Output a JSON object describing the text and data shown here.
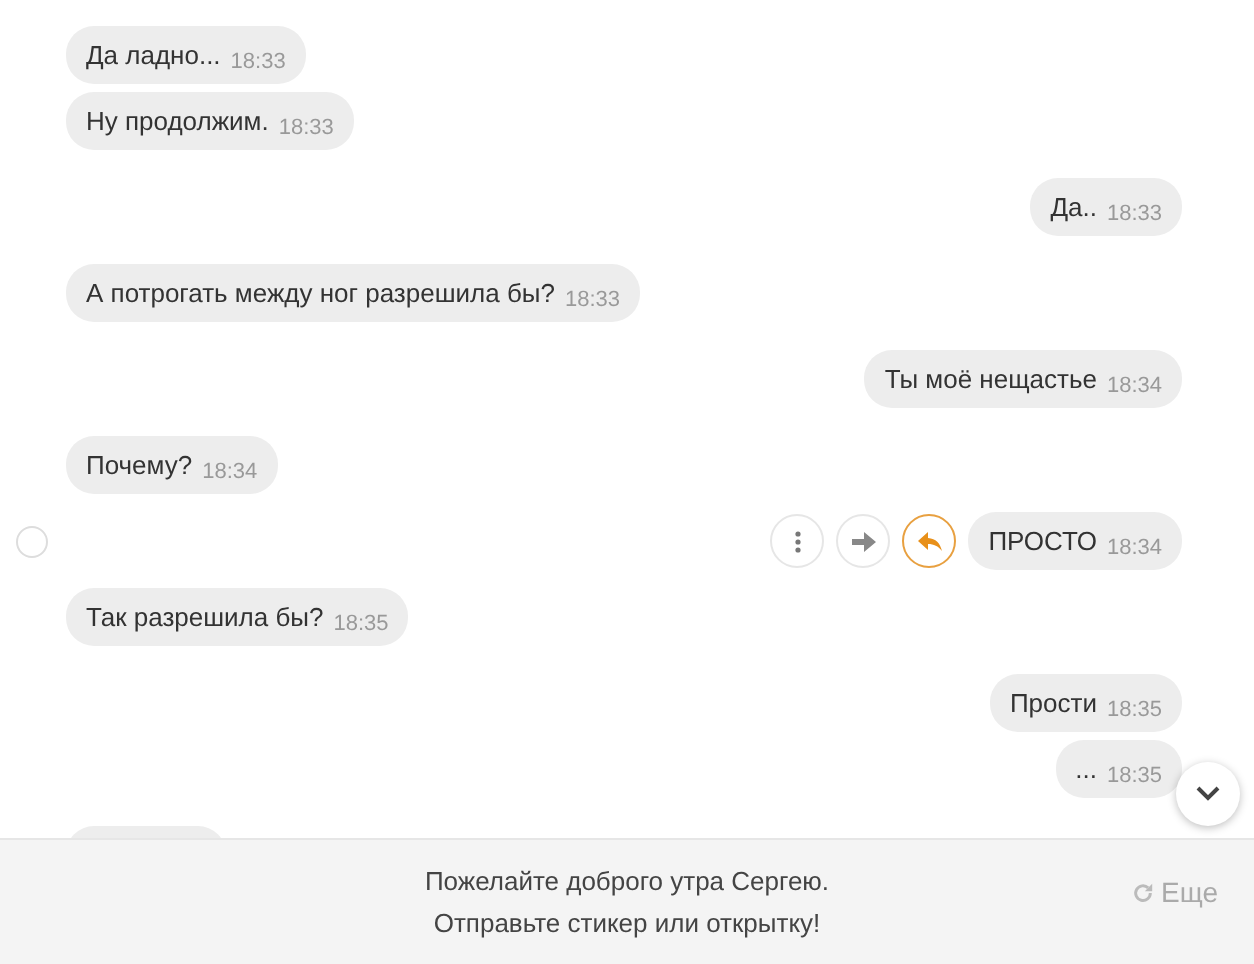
{
  "messages": [
    {
      "outgoing": false,
      "text": "Да ладно...",
      "time": "18:33",
      "actions_visible": false
    },
    {
      "outgoing": false,
      "text": "Ну продолжим.",
      "time": "18:33",
      "actions_visible": false
    },
    {
      "outgoing": true,
      "text": "Да..",
      "time": "18:33",
      "actions_visible": false
    },
    {
      "outgoing": false,
      "text": "А потрогать между ног разрешила бы?",
      "time": "18:33",
      "actions_visible": false
    },
    {
      "outgoing": true,
      "text": "Ты моё нещастье",
      "time": "18:34",
      "actions_visible": false
    },
    {
      "outgoing": false,
      "text": "Почему?",
      "time": "18:34",
      "actions_visible": false
    },
    {
      "outgoing": true,
      "text": "ПРОСТО",
      "time": "18:34",
      "actions_visible": true
    },
    {
      "outgoing": false,
      "text": "Так разрешила бы?",
      "time": "18:35",
      "actions_visible": false
    },
    {
      "outgoing": true,
      "text": "Прости",
      "time": "18:35",
      "actions_visible": false
    },
    {
      "outgoing": true,
      "text": "...",
      "time": "18:35",
      "actions_visible": false
    },
    {
      "outgoing": false,
      "actions_visible": false
    }
  ],
  "suggestion": {
    "lines": [
      "Пожелайте доброго утра Сергею.",
      "Отправьте стикер или открытку!"
    ],
    "more": "Еще"
  }
}
